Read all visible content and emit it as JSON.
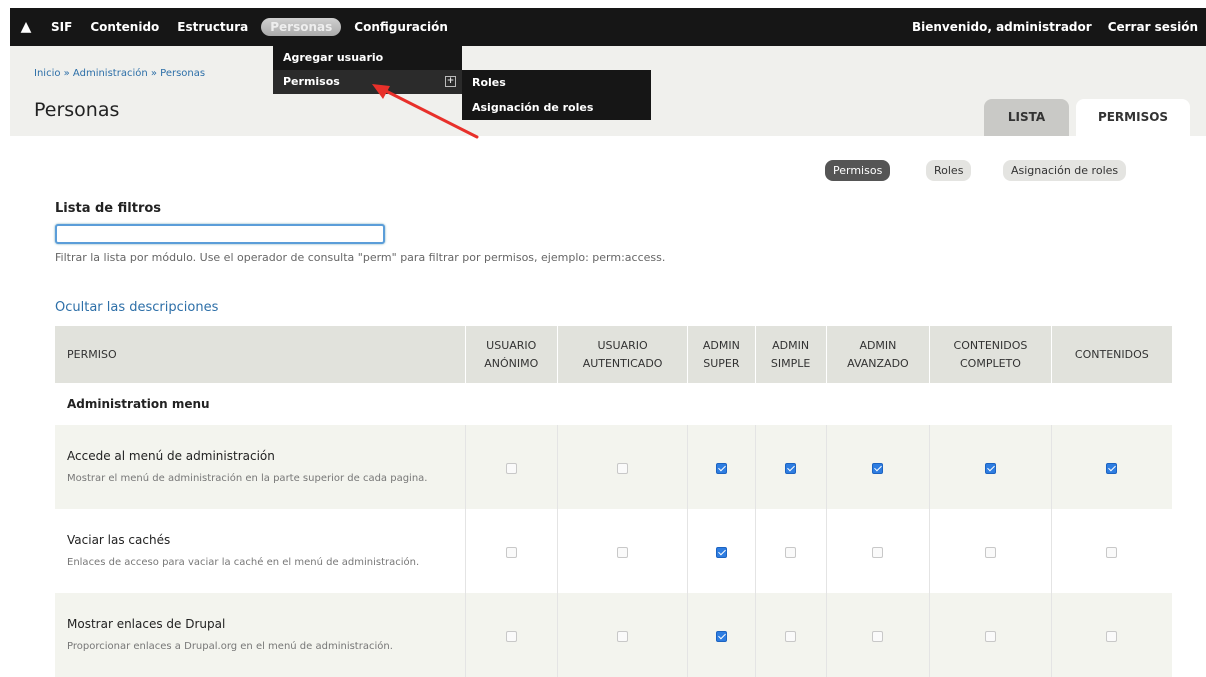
{
  "toolbar": {
    "items": [
      "SIF",
      "Contenido",
      "Estructura",
      "Personas",
      "Configuración"
    ],
    "welcome": "Bienvenido, administrador",
    "logout": "Cerrar sesión"
  },
  "menu": {
    "add_user": "Agregar usuario",
    "permissions": "Permisos",
    "sub": [
      "Roles",
      "Asignación de roles"
    ]
  },
  "header": {
    "breadcrumb": "Inicio » Administración » Personas",
    "title": "Personas",
    "tabs": [
      "LISTA",
      "PERMISOS"
    ]
  },
  "subtabs": [
    "Permisos",
    "Roles",
    "Asignación de roles"
  ],
  "filter": {
    "label": "Lista de filtros",
    "value": "",
    "description": "Filtrar la lista por módulo. Use el operador de consulta \"perm\" para filtrar por permisos, ejemplo: perm:access.",
    "toggle": "Ocultar las descripciones"
  },
  "table": {
    "headers": [
      "PERMISO",
      [
        "USUARIO",
        "ANÓNIMO"
      ],
      [
        "USUARIO",
        "AUTENTICADO"
      ],
      [
        "ADMIN",
        "SUPER"
      ],
      [
        "ADMIN",
        "SIMPLE"
      ],
      [
        "ADMIN",
        "AVANZADO"
      ],
      [
        "CONTENIDOS",
        "COMPLETO"
      ],
      "CONTENIDOS"
    ],
    "module": "Administration menu",
    "rows": [
      {
        "title": "Accede al menú de administración",
        "desc": "Mostrar el menú de administración en la parte superior de cada pagina.",
        "checks": [
          false,
          false,
          true,
          true,
          true,
          true,
          true
        ]
      },
      {
        "title": "Vaciar las cachés",
        "desc": "Enlaces de acceso para vaciar la caché en el menú de administración.",
        "checks": [
          false,
          false,
          true,
          false,
          false,
          false,
          false
        ]
      },
      {
        "title": "Mostrar enlaces de Drupal",
        "desc": "Proporcionar enlaces a Drupal.org en el menú de administración.",
        "checks": [
          false,
          false,
          true,
          false,
          false,
          false,
          false
        ]
      }
    ]
  },
  "colors": {
    "toolbar": "#161616",
    "link": "#2d6fa8",
    "checked": "#2e7de1",
    "arrow": "#e8302a"
  }
}
